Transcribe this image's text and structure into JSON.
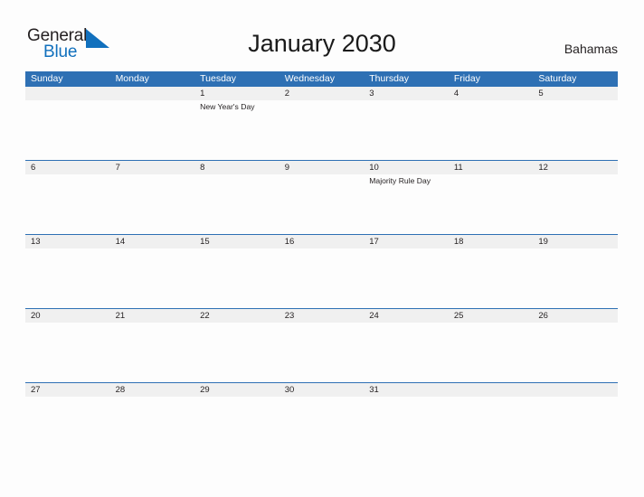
{
  "brand": {
    "name_part1": "General",
    "name_part2": "Blue",
    "flag_icon": "flag-triangle-icon",
    "accent_color": "#1170bd"
  },
  "header": {
    "title": "January 2030",
    "country": "Bahamas"
  },
  "colors": {
    "header_blue": "#2e70b4",
    "date_band_gray": "#f0f0f0",
    "row_divider": "#2e70b4",
    "text": "#231f20",
    "page_background": "#fdfdfd"
  },
  "calendar": {
    "weekday_headers": [
      "Sunday",
      "Monday",
      "Tuesday",
      "Wednesday",
      "Thursday",
      "Friday",
      "Saturday"
    ],
    "weeks": [
      {
        "dates": [
          "",
          "",
          "1",
          "2",
          "3",
          "4",
          "5"
        ],
        "events": [
          "",
          "",
          "New Year's Day",
          "",
          "",
          "",
          ""
        ]
      },
      {
        "dates": [
          "6",
          "7",
          "8",
          "9",
          "10",
          "11",
          "12"
        ],
        "events": [
          "",
          "",
          "",
          "",
          "Majority Rule Day",
          "",
          ""
        ]
      },
      {
        "dates": [
          "13",
          "14",
          "15",
          "16",
          "17",
          "18",
          "19"
        ],
        "events": [
          "",
          "",
          "",
          "",
          "",
          "",
          ""
        ]
      },
      {
        "dates": [
          "20",
          "21",
          "22",
          "23",
          "24",
          "25",
          "26"
        ],
        "events": [
          "",
          "",
          "",
          "",
          "",
          "",
          ""
        ]
      },
      {
        "dates": [
          "27",
          "28",
          "29",
          "30",
          "31",
          "",
          ""
        ],
        "events": [
          "",
          "",
          "",
          "",
          "",
          "",
          ""
        ]
      }
    ]
  }
}
